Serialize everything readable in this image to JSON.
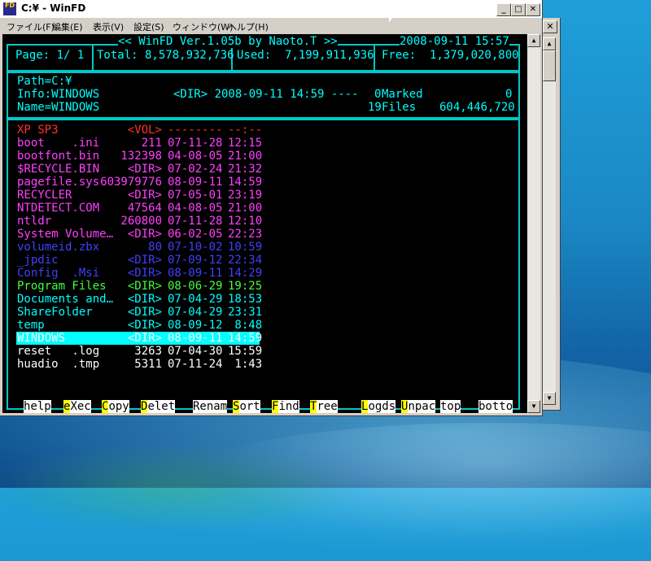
{
  "window": {
    "title": "C:¥ - WinFD",
    "icon_text": "FD"
  },
  "menu": [
    "ファイル(F)",
    "編集(E)",
    "表示(V)",
    "設定(S)",
    "ウィンドウ(W)",
    "ヘルプ(H)"
  ],
  "header": {
    "banner": "<< WinFD Ver.1.05b by Naoto.T >>",
    "datetime": "2008-09-11 15:57",
    "page": "Page: 1/ 1",
    "total": "Total: 8,578,932,736",
    "used": "Used:  7,199,911,936",
    "free": "Free:  1,379,020,800"
  },
  "info": {
    "path": "Path=C:¥",
    "info": "Info:WINDOWS",
    "info_detail": "<DIR> 2008-09-11 14:59 ----",
    "name": "Name=WINDOWS",
    "marked_count": "0",
    "marked_label": "Marked",
    "marked_size": "0",
    "files_count": "19",
    "files_label": "Files",
    "files_size": "604,446,720"
  },
  "files": [
    {
      "name": "XP SP3",
      "size": "<VOL>",
      "date": "--------",
      "time": "--:--",
      "color": "red"
    },
    {
      "name": "boot    .ini",
      "size": "211",
      "date": "07-11-28",
      "time": "12:15",
      "color": "mag"
    },
    {
      "name": "bootfont.bin",
      "size": "132398",
      "date": "04-08-05",
      "time": "21:00",
      "color": "mag"
    },
    {
      "name": "$RECYCLE.BIN",
      "size": "<DIR>",
      "date": "07-02-24",
      "time": "21:32",
      "color": "mag"
    },
    {
      "name": "pagefile.sys",
      "size": "603979776",
      "date": "08-09-11",
      "time": "14:59",
      "color": "mag"
    },
    {
      "name": "RECYCLER",
      "size": "<DIR>",
      "date": "07-05-01",
      "time": "23:19",
      "color": "mag"
    },
    {
      "name": "NTDETECT.COM",
      "size": "47564",
      "date": "04-08-05",
      "time": "21:00",
      "color": "mag"
    },
    {
      "name": "ntldr",
      "size": "260800",
      "date": "07-11-28",
      "time": "12:10",
      "color": "mag"
    },
    {
      "name": "System Volume…",
      "size": "<DIR>",
      "date": "06-02-05",
      "time": "22:23",
      "color": "mag"
    },
    {
      "name": "volumeid.zbx",
      "size": "80",
      "date": "07-10-02",
      "time": "10:59",
      "color": "blue"
    },
    {
      "name": "_jpdic",
      "size": "<DIR>",
      "date": "07-09-12",
      "time": "22:34",
      "color": "blue"
    },
    {
      "name": "Config  .Msi",
      "size": "<DIR>",
      "date": "08-09-11",
      "time": "14:29",
      "color": "blue"
    },
    {
      "name": "Program Files",
      "size": "<DIR>",
      "date": "08-06-29",
      "time": "19:25",
      "color": "grn"
    },
    {
      "name": "Documents and…",
      "size": "<DIR>",
      "date": "07-04-29",
      "time": "18:53",
      "color": "cyan"
    },
    {
      "name": "ShareFolder",
      "size": "<DIR>",
      "date": "07-04-29",
      "time": "23:31",
      "color": "cyan"
    },
    {
      "name": "temp",
      "size": "<DIR>",
      "date": "08-09-12",
      "time": " 8:48",
      "color": "cyan"
    },
    {
      "name": "WINDOWS",
      "size": "<DIR>",
      "date": "08-09-11",
      "time": "14:59",
      "color": "cyan",
      "selected": true
    },
    {
      "name": "reset   .log",
      "size": "3263",
      "date": "07-04-30",
      "time": "15:59",
      "color": "wht"
    },
    {
      "name": "huadio  .tmp",
      "size": "5311",
      "date": "07-11-24",
      "time": " 1:43",
      "color": "wht"
    }
  ],
  "fkeys": [
    {
      "key": "",
      "label": "help"
    },
    {
      "key": "e",
      "label": "Xec"
    },
    {
      "key": "C",
      "label": "opy"
    },
    {
      "key": "D",
      "label": "elet"
    },
    {
      "key": "",
      "label": "Renam"
    },
    {
      "key": "S",
      "label": "ort"
    },
    {
      "key": "F",
      "label": "ind"
    },
    {
      "key": "T",
      "label": "ree"
    },
    {
      "key": "L",
      "label": "ogds"
    },
    {
      "key": "U",
      "label": "npac"
    },
    {
      "key": "",
      "label": "top"
    },
    {
      "key": "",
      "label": "botto"
    }
  ],
  "colors": {
    "red": "#ff3030",
    "mag": "#ff40ff",
    "blue": "#4040ff",
    "grn": "#40ff40",
    "cyan": "#00ffff",
    "wht": "#ffffff",
    "frame": "#00c8c8",
    "hotkey": "#ffff00"
  }
}
